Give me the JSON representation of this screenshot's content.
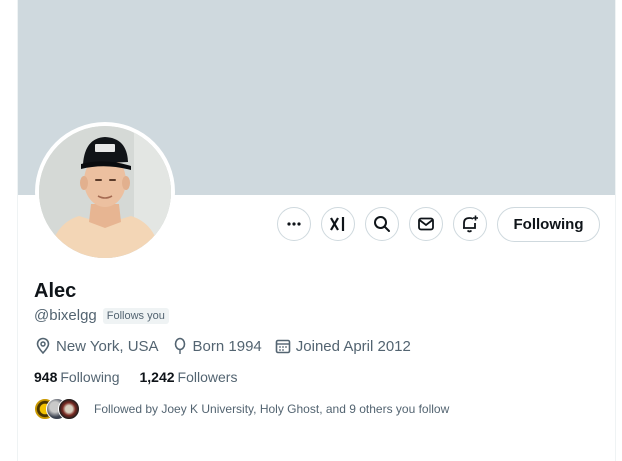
{
  "profile": {
    "name": "Alec",
    "handle": "@bixelgg",
    "follows_you_badge": "Follows you",
    "location": "New York, USA",
    "born": "Born 1994",
    "joined": "Joined April 2012",
    "following_count": "948",
    "following_label": "Following",
    "followers_count": "1,242",
    "followers_label": "Followers",
    "followed_by_text": "Followed by Joey K University, Holy Ghost, and 9 others you follow"
  },
  "actions": {
    "more_icon": "more-icon",
    "grok_icon": "grok-icon",
    "search_icon": "search-icon",
    "message_icon": "envelope-icon",
    "notify_icon": "bell-plus-icon",
    "following_button": "Following"
  },
  "colors": {
    "banner": "#cfd9de",
    "text_primary": "#0f1419",
    "text_secondary": "#536471",
    "border": "#cfd9de"
  }
}
